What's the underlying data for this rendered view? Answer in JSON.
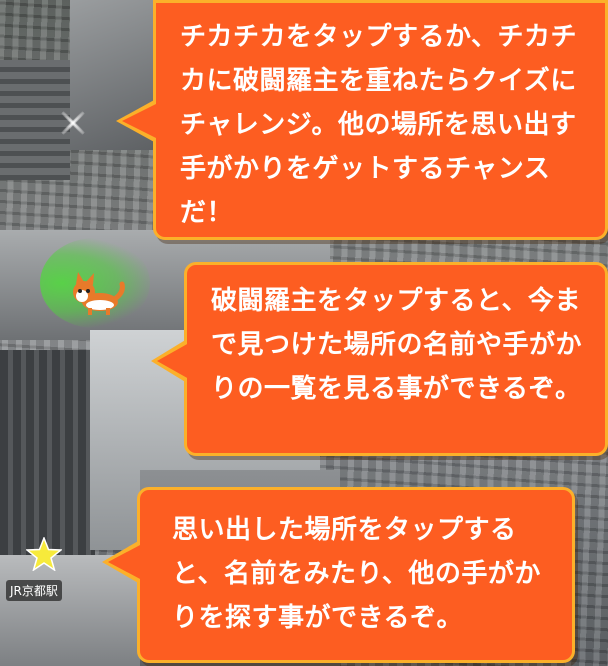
{
  "map": {
    "station_label": "JR京都駅"
  },
  "tutorial": {
    "bubble_1": "チカチカをタップするか、チカチカに破闘羅主を重ねたらクイズにチャレンジ。他の場所を思い出す手がかりをゲットするチャンスだ！",
    "bubble_2": "破闘羅主をタップすると、今まで見つけた場所の名前や手がかりの一覧を見る事ができるぞ。",
    "bubble_3": "思い出した場所をタップすると、名前をみたり、他の手がかりを探す事ができるぞ。"
  },
  "colors": {
    "bubble_fill": "#fd5d21",
    "bubble_border": "#fbb02a",
    "star": "#f7ea3b",
    "cone": "#50dc3c"
  }
}
